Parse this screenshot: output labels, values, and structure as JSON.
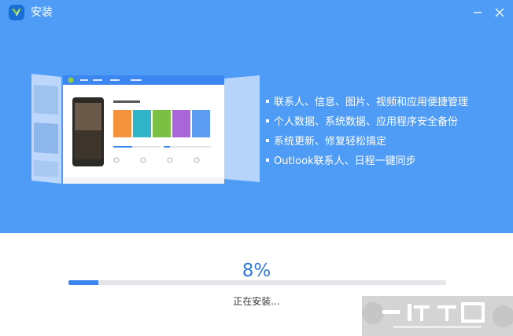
{
  "window": {
    "title": "安装",
    "minimize_icon": "minimize-icon",
    "close_icon": "close-icon"
  },
  "colors": {
    "header_bg": "#4f9cf6",
    "accent": "#2f78d6",
    "progress_fill": "#3b86f0",
    "progress_track": "#e3e5e8"
  },
  "features": [
    "联系人、信息、图片、视频和应用便捷管理",
    "个人数据、系统数据、应用程序安全备份",
    "系统更新、修复轻松搞定",
    "Outlook联系人、日程一键同步"
  ],
  "install": {
    "percent_label": "8%",
    "progress": 0.08,
    "status": "正在安装..."
  },
  "watermark": {
    "text": "一位下载",
    "sub": "YITIXIAZAI"
  }
}
